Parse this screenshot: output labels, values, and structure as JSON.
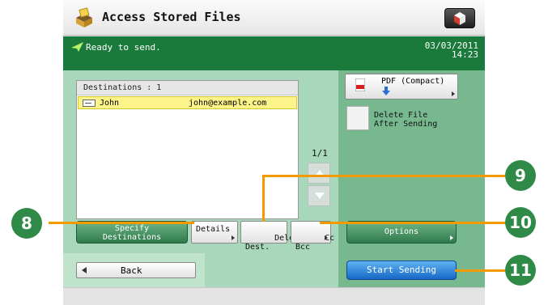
{
  "header": {
    "title": "Access Stored Files"
  },
  "status": {
    "text": "Ready to send.",
    "date": "03/03/2011",
    "time": "14:23"
  },
  "destinations": {
    "header": "Destinations  : 1",
    "rows": [
      {
        "name": "John",
        "email": "john@example.com"
      }
    ],
    "page": "1/1"
  },
  "buttons": {
    "specify": "Specify\nDestinations",
    "details": "Details",
    "delete_dest": "Delete\nDest.",
    "cc_bcc": "Cc\nBcc",
    "options": "Options",
    "back": "Back",
    "start_sending": "Start Sending"
  },
  "file_settings": {
    "format": "PDF (Compact)",
    "delete_file": "Delete File\nAfter Sending"
  },
  "callouts": [
    "8",
    "9",
    "10",
    "11"
  ],
  "colors": {
    "status_green": "#1a7a3c",
    "callout_orange": "#f39a00",
    "badge_green": "#2f8a47",
    "start_blue": "#1768c6"
  }
}
